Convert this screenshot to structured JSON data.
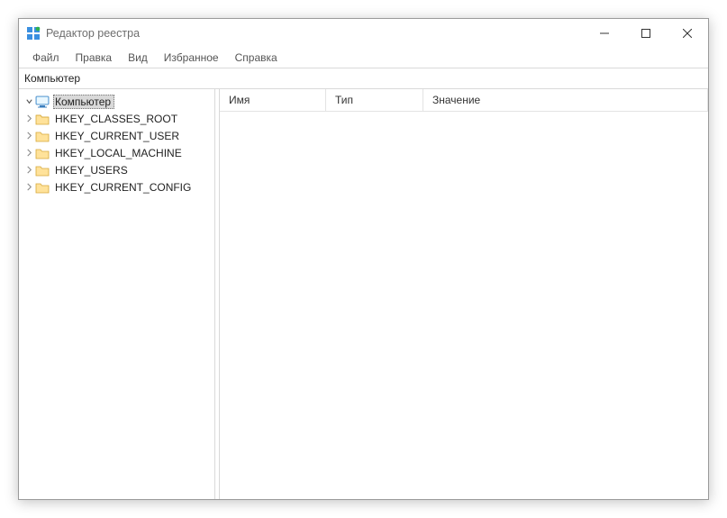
{
  "window": {
    "title": "Редактор реестра"
  },
  "menu": {
    "file": "Файл",
    "edit": "Правка",
    "view": "Вид",
    "favorites": "Избранное",
    "help": "Справка"
  },
  "address": {
    "path": "Компьютер"
  },
  "tree": {
    "root": {
      "label": "Компьютер",
      "expanded": true,
      "selected": true
    },
    "children": [
      {
        "label": "HKEY_CLASSES_ROOT"
      },
      {
        "label": "HKEY_CURRENT_USER"
      },
      {
        "label": "HKEY_LOCAL_MACHINE"
      },
      {
        "label": "HKEY_USERS"
      },
      {
        "label": "HKEY_CURRENT_CONFIG"
      }
    ]
  },
  "columns": {
    "name": "Имя",
    "type": "Тип",
    "value": "Значение"
  }
}
